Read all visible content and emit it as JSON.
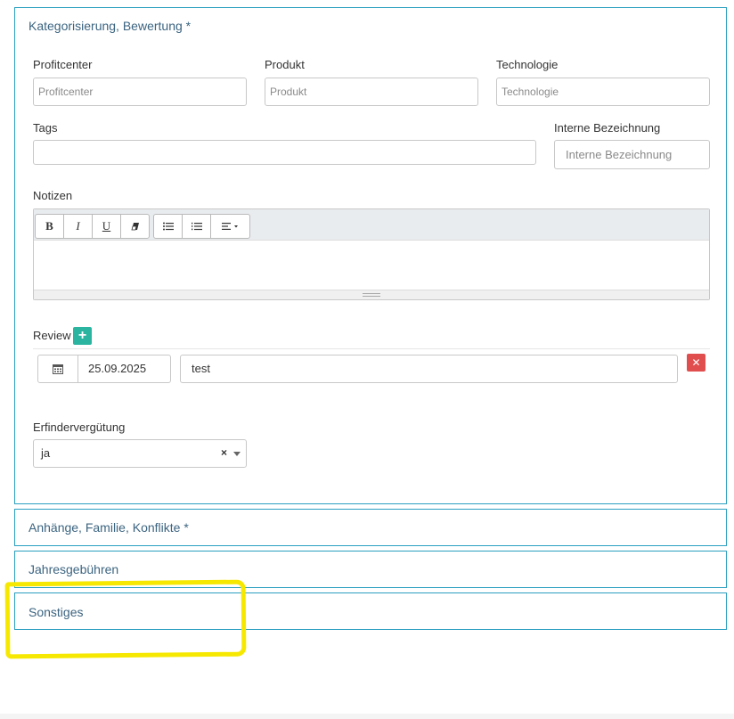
{
  "sections": {
    "categorization": {
      "title": "Kategorisierung, Bewertung *"
    },
    "attachments": {
      "title": "Anhänge, Familie, Konflikte *"
    },
    "annual_fees": {
      "title": "Jahresgebühren"
    },
    "misc": {
      "title": "Sonstiges"
    }
  },
  "fields": {
    "profitcenter": {
      "label": "Profitcenter",
      "placeholder": "Profitcenter",
      "value": ""
    },
    "produkt": {
      "label": "Produkt",
      "placeholder": "Produkt",
      "value": ""
    },
    "technologie": {
      "label": "Technologie",
      "placeholder": "Technologie",
      "value": ""
    },
    "tags": {
      "label": "Tags",
      "value": ""
    },
    "interne_bezeichnung": {
      "label": "Interne Bezeichnung",
      "placeholder": "Interne Bezeichnung",
      "value": ""
    },
    "notizen": {
      "label": "Notizen"
    }
  },
  "editor_toolbar": {
    "bold": "B",
    "italic": "I",
    "underline": "U",
    "clear_icon": "eraser-icon",
    "ul_icon": "unordered-list-icon",
    "ol_icon": "ordered-list-icon",
    "align_icon": "align-dropdown-icon"
  },
  "review": {
    "label": "Review",
    "add_icon": "plus-icon",
    "date": "25.09.2025",
    "date_icon": "calendar-icon",
    "text": "test",
    "delete_icon": "close-icon"
  },
  "erfindervergutung": {
    "label": "Erfindervergütung",
    "selected": "ja",
    "clear_glyph": "×"
  },
  "colors": {
    "panel_border": "#2a9fc0",
    "add_button": "#2bb5a0",
    "delete_button": "#e04e4e",
    "highlight": "#f6e800"
  }
}
